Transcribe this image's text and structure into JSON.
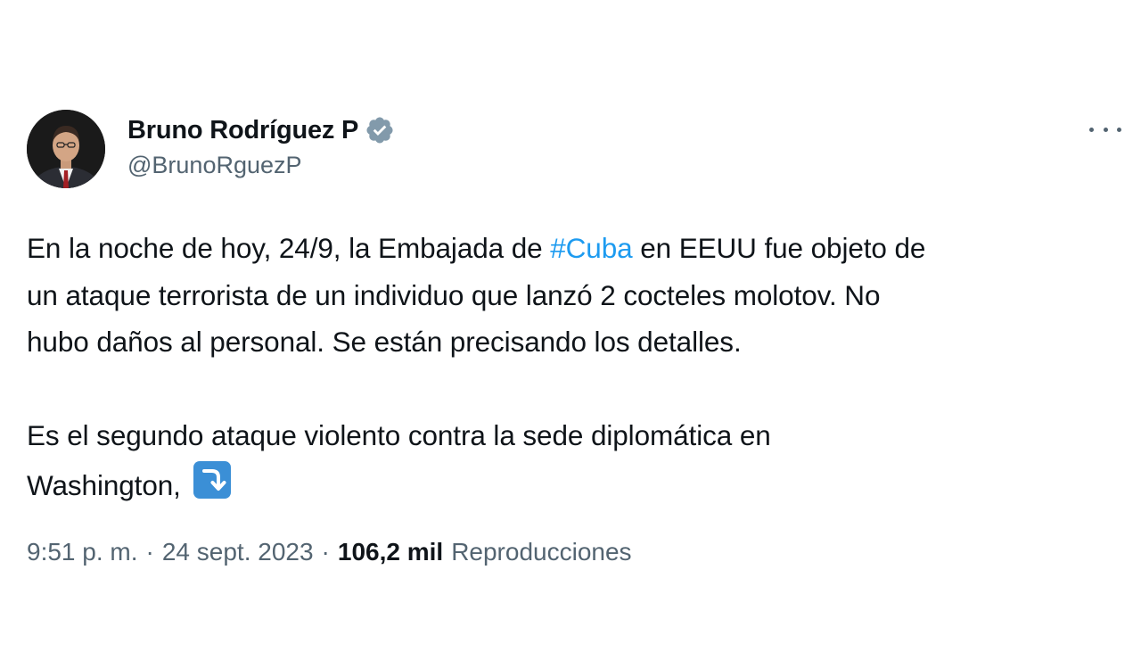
{
  "tweet": {
    "author": {
      "display_name": "Bruno Rodríguez P",
      "handle": "@BrunoRguezP",
      "verified": true,
      "verified_color": "#829aab"
    },
    "text": {
      "line1_before": "En la noche de hoy, 24/9, la Embajada de ",
      "hashtag": "#Cuba",
      "line1_after": " en EEUU fue objeto de",
      "line2": "un ataque terrorista de un individuo que lanzó 2 cocteles molotov. No",
      "line3": "hubo daños al personal. Se están precisando los detalles.",
      "line4": "Es el segundo ataque violento contra la sede diplomática en",
      "line5": "Washington, ",
      "emoji_icon": "right-arrow-curving-down-icon"
    },
    "meta": {
      "time": "9:51 p. m.",
      "separator": "·",
      "date": "24 sept. 2023",
      "views_count": "106,2 mil",
      "views_label": "Reproducciones"
    },
    "colors": {
      "link": "#1d9bf0",
      "secondary_text": "#536471",
      "primary_text": "#0f1419"
    }
  }
}
